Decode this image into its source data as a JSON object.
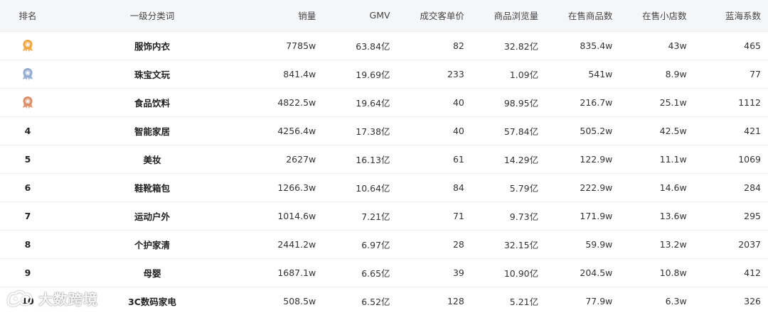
{
  "columns": {
    "rank": "排名",
    "category": "一级分类词",
    "sales": "销量",
    "gmv": "GMV",
    "avg_price": "成交客单价",
    "views": "商品浏览量",
    "items_on_sale": "在售商品数",
    "shops_on_sale": "在售小店数",
    "blue_ocean": "蓝海系数"
  },
  "medal_colors": {
    "gold": "#f0a23a",
    "silver": "#8fa8cf",
    "bronze": "#d98a5e"
  },
  "rows": [
    {
      "rank": "1",
      "medal": "gold",
      "category": "服饰内衣",
      "sales": "7785w",
      "gmv": "63.84亿",
      "avg_price": "82",
      "views": "32.82亿",
      "items_on_sale": "835.4w",
      "shops_on_sale": "43w",
      "blue_ocean": "465"
    },
    {
      "rank": "2",
      "medal": "silver",
      "category": "珠宝文玩",
      "sales": "841.4w",
      "gmv": "19.69亿",
      "avg_price": "233",
      "views": "1.09亿",
      "items_on_sale": "541w",
      "shops_on_sale": "8.9w",
      "blue_ocean": "77"
    },
    {
      "rank": "3",
      "medal": "bronze",
      "category": "食品饮料",
      "sales": "4822.5w",
      "gmv": "19.64亿",
      "avg_price": "40",
      "views": "98.95亿",
      "items_on_sale": "216.7w",
      "shops_on_sale": "25.1w",
      "blue_ocean": "1112"
    },
    {
      "rank": "4",
      "category": "智能家居",
      "sales": "4256.4w",
      "gmv": "17.38亿",
      "avg_price": "40",
      "views": "57.84亿",
      "items_on_sale": "505.2w",
      "shops_on_sale": "42.5w",
      "blue_ocean": "421"
    },
    {
      "rank": "5",
      "category": "美妆",
      "sales": "2627w",
      "gmv": "16.13亿",
      "avg_price": "61",
      "views": "14.29亿",
      "items_on_sale": "122.9w",
      "shops_on_sale": "11.1w",
      "blue_ocean": "1069"
    },
    {
      "rank": "6",
      "category": "鞋靴箱包",
      "sales": "1266.3w",
      "gmv": "10.64亿",
      "avg_price": "84",
      "views": "5.79亿",
      "items_on_sale": "222.9w",
      "shops_on_sale": "14.6w",
      "blue_ocean": "284"
    },
    {
      "rank": "7",
      "category": "运动户外",
      "sales": "1014.6w",
      "gmv": "7.21亿",
      "avg_price": "71",
      "views": "9.73亿",
      "items_on_sale": "171.9w",
      "shops_on_sale": "13.6w",
      "blue_ocean": "295"
    },
    {
      "rank": "8",
      "category": "个护家清",
      "sales": "2441.2w",
      "gmv": "6.97亿",
      "avg_price": "28",
      "views": "32.15亿",
      "items_on_sale": "59.9w",
      "shops_on_sale": "13.2w",
      "blue_ocean": "2037"
    },
    {
      "rank": "9",
      "category": "母婴",
      "sales": "1687.1w",
      "gmv": "6.65亿",
      "avg_price": "39",
      "views": "10.90亿",
      "items_on_sale": "204.5w",
      "shops_on_sale": "10.8w",
      "blue_ocean": "412"
    },
    {
      "rank": "10",
      "category": "3C数码家电",
      "sales": "508.5w",
      "gmv": "6.52亿",
      "avg_price": "128",
      "views": "5.21亿",
      "items_on_sale": "77.9w",
      "shops_on_sale": "6.3w",
      "blue_ocean": "326"
    }
  ],
  "watermark": {
    "text": "大数跨境"
  }
}
